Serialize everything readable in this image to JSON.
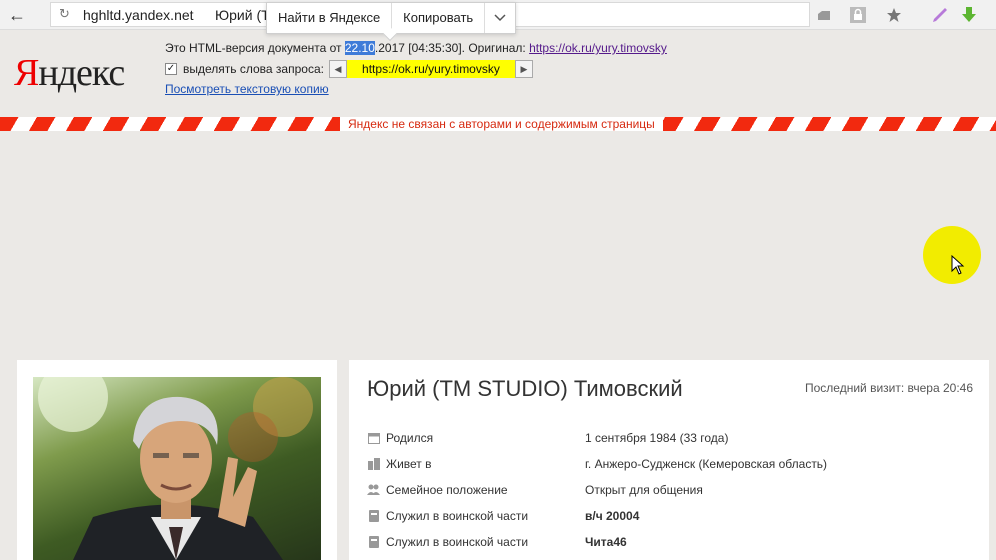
{
  "browser": {
    "host": "hghltd.yandex.net",
    "title_partial": "Юрий (Т",
    "popup": {
      "find_label": "Найти в Яндексе",
      "copy_label": "Копировать"
    }
  },
  "cache": {
    "logo": {
      "first": "Я",
      "rest": "ндекс"
    },
    "notice_prefix": "Это HTML-версия документа от ",
    "date_highlight": "22.10",
    "date_rest": ".2017 [04:35:30]. Оригинал: ",
    "original_link": "https://ok.ru/yury.timovsky",
    "highlight_label": "выделять слова запроса:",
    "query": "https://ok.ru/yury.timovsky",
    "text_copy_link": "Посмотреть текстовую копию"
  },
  "stripe_text": "Яндекс не связан с авторами и содержимым страницы",
  "profile": {
    "name": "Юрий (TM STUDIO) Тимовский",
    "last_visit": "Последний визит: вчера 20:46",
    "rows": [
      {
        "icon": "calendar-icon",
        "label": "Родился",
        "value": "1 сентября 1984 (33 года)"
      },
      {
        "icon": "buildings-icon",
        "label": "Живет в",
        "value": "г. Анжеро-Судженск (Кемеровская область)"
      },
      {
        "icon": "people-icon",
        "label": "Семейное положение",
        "value": "Открыт для общения"
      },
      {
        "icon": "badge-icon",
        "label": "Служил в воинской части",
        "value": "в/ч 20004"
      },
      {
        "icon": "badge-icon",
        "label": "Служил в воинской части",
        "value": "Чита46"
      }
    ]
  },
  "colors": {
    "stripe_red": "#f2290f",
    "query_highlight": "#ffff00",
    "cursor_highlight": "#f2ec00",
    "selection": "#3e7bd8"
  }
}
